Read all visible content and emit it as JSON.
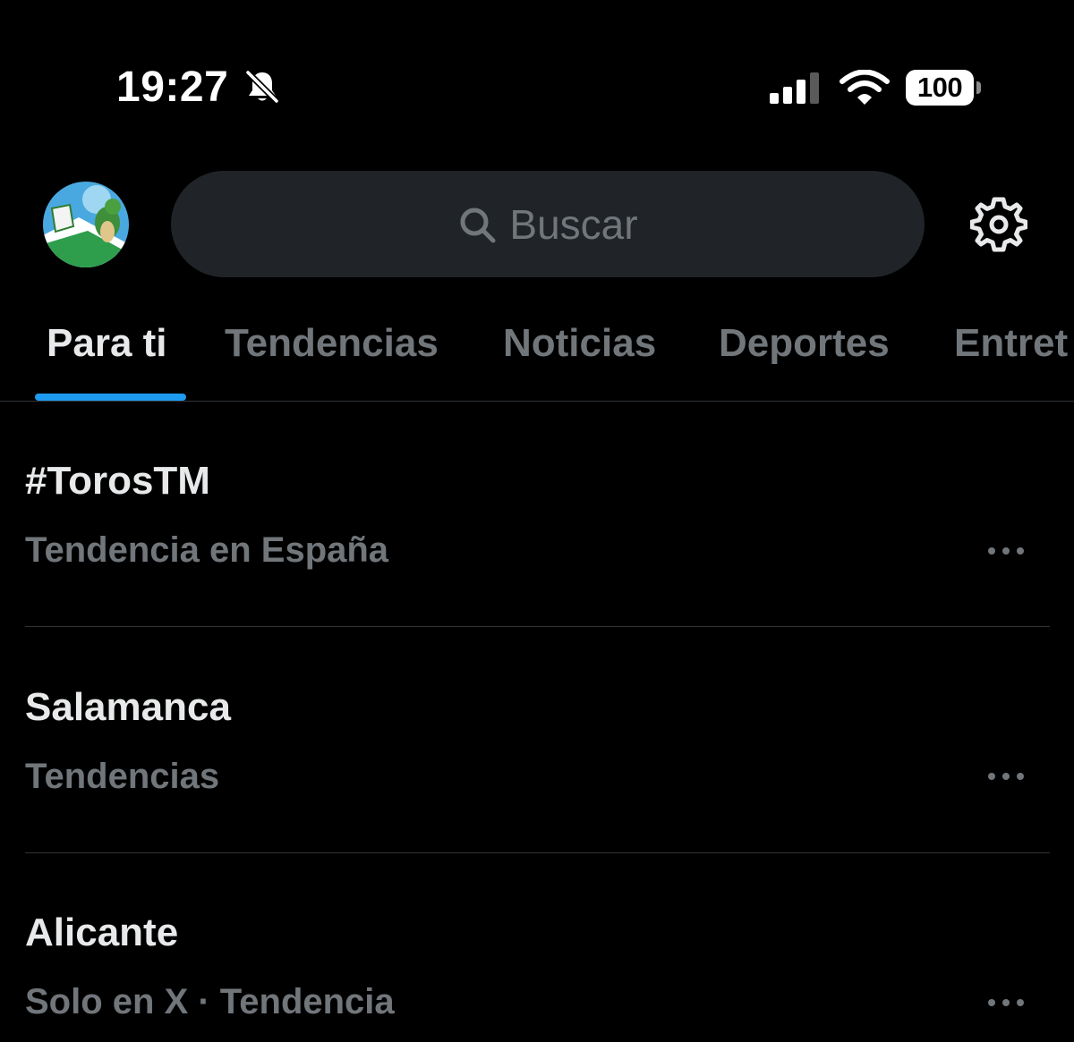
{
  "status_bar": {
    "time": "19:27",
    "battery_level": "100",
    "icons": [
      "bell-off-icon",
      "signal-icon",
      "wifi-icon",
      "battery-icon"
    ]
  },
  "header": {
    "search": {
      "placeholder": "Buscar",
      "icon": "search-icon"
    },
    "settings_icon": "gear-icon"
  },
  "tabs": [
    {
      "label": "Para ti",
      "active": true
    },
    {
      "label": "Tendencias",
      "active": false
    },
    {
      "label": "Noticias",
      "active": false
    },
    {
      "label": "Deportes",
      "active": false
    },
    {
      "label": "Entret",
      "active": false
    }
  ],
  "trends": [
    {
      "title": "#TorosTM",
      "meta": "Tendencia en España"
    },
    {
      "title": "Salamanca",
      "meta": "Tendencias"
    },
    {
      "title": "Alicante",
      "meta": "Solo en X · Tendencia"
    }
  ],
  "colors": {
    "background": "#000000",
    "accent": "#1d9bf0",
    "text_primary": "#e7e9ea",
    "text_secondary": "#71767b",
    "search_bg": "#202327",
    "divider": "#2f3336"
  }
}
